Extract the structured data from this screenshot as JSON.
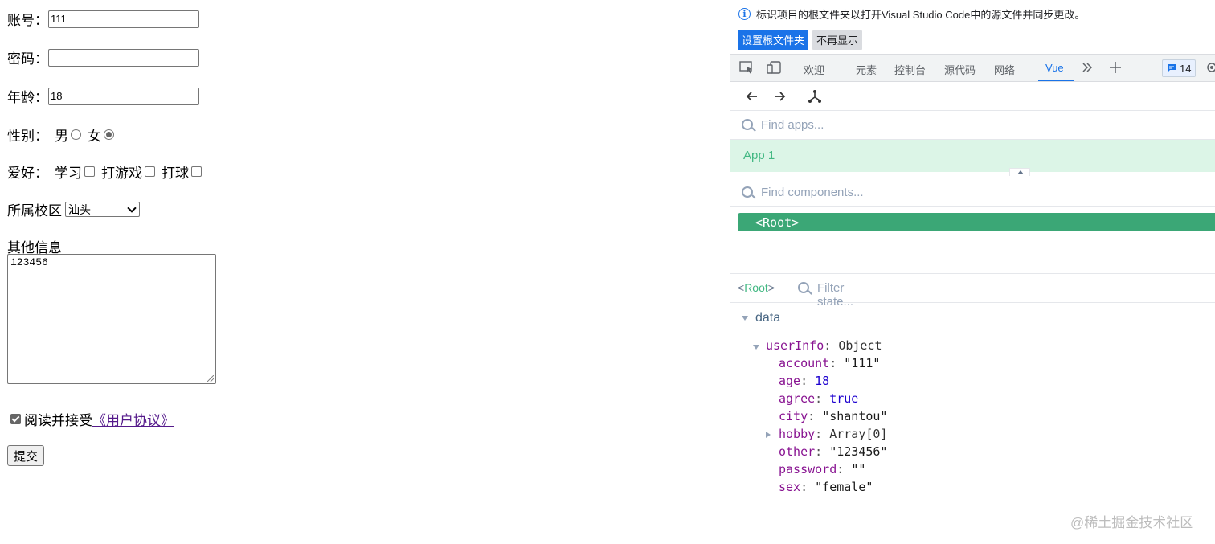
{
  "form": {
    "account": {
      "label": "账号：",
      "value": "111"
    },
    "password": {
      "label": "密码：",
      "value": ""
    },
    "age": {
      "label": "年龄：",
      "value": "18"
    },
    "sex": {
      "label": "性别：",
      "options": [
        {
          "label": "男",
          "checked": false
        },
        {
          "label": "女",
          "checked": true
        }
      ]
    },
    "hobby": {
      "label": "爱好：",
      "options": [
        {
          "label": "学习",
          "checked": false
        },
        {
          "label": "打游戏",
          "checked": false
        },
        {
          "label": "打球",
          "checked": false
        }
      ]
    },
    "campus": {
      "label": "所属校区",
      "selected": "汕头"
    },
    "other": {
      "label": "其他信息",
      "value": "123456"
    },
    "agree": {
      "checked": true,
      "text": "阅读并接受",
      "link": "《用户协议》"
    },
    "submit_label": "提交"
  },
  "devtools": {
    "notice": {
      "icon": "info-icon",
      "text": "标识项目的根文件夹以打开Visual Studio Code中的源文件并同步更改。"
    },
    "set_root_button": "设置根文件夹",
    "dismiss_button": "不再显示",
    "tabs": [
      {
        "label": "欢迎",
        "active": false
      },
      {
        "label": "元素",
        "active": false
      },
      {
        "label": "控制台",
        "active": false
      },
      {
        "label": "源代码",
        "active": false
      },
      {
        "label": "网络",
        "active": false
      },
      {
        "label": "Vue",
        "active": true
      }
    ],
    "issues_count": "14",
    "vue": {
      "find_apps_placeholder": "Find apps...",
      "app_name": "App 1",
      "find_components_placeholder": "Find components...",
      "root_node": "<Root>",
      "state_root_name": "Root",
      "filter_state_placeholder": "Filter state...",
      "section": "data",
      "object_key": "userInfo",
      "object_type": "Object",
      "props": [
        {
          "key": "account",
          "value": "\"111\"",
          "kind": "string"
        },
        {
          "key": "age",
          "value": "18",
          "kind": "number"
        },
        {
          "key": "agree",
          "value": "true",
          "kind": "bool"
        },
        {
          "key": "city",
          "value": "\"shantou\"",
          "kind": "string"
        },
        {
          "key": "hobby",
          "value": "Array[0]",
          "kind": "object",
          "collapsed": true
        },
        {
          "key": "other",
          "value": "\"123456\"",
          "kind": "string"
        },
        {
          "key": "password",
          "value": "\"\"",
          "kind": "string"
        },
        {
          "key": "sex",
          "value": "\"female\"",
          "kind": "string"
        }
      ]
    }
  },
  "watermark": "@稀土掘金技术社区",
  "colors": {
    "vue_green": "#42b883",
    "root_node_bg": "#3ba776",
    "app_row_bg": "#dcf5e7",
    "primary_blue": "#1a73e8",
    "link_purple": "#551a8b"
  }
}
